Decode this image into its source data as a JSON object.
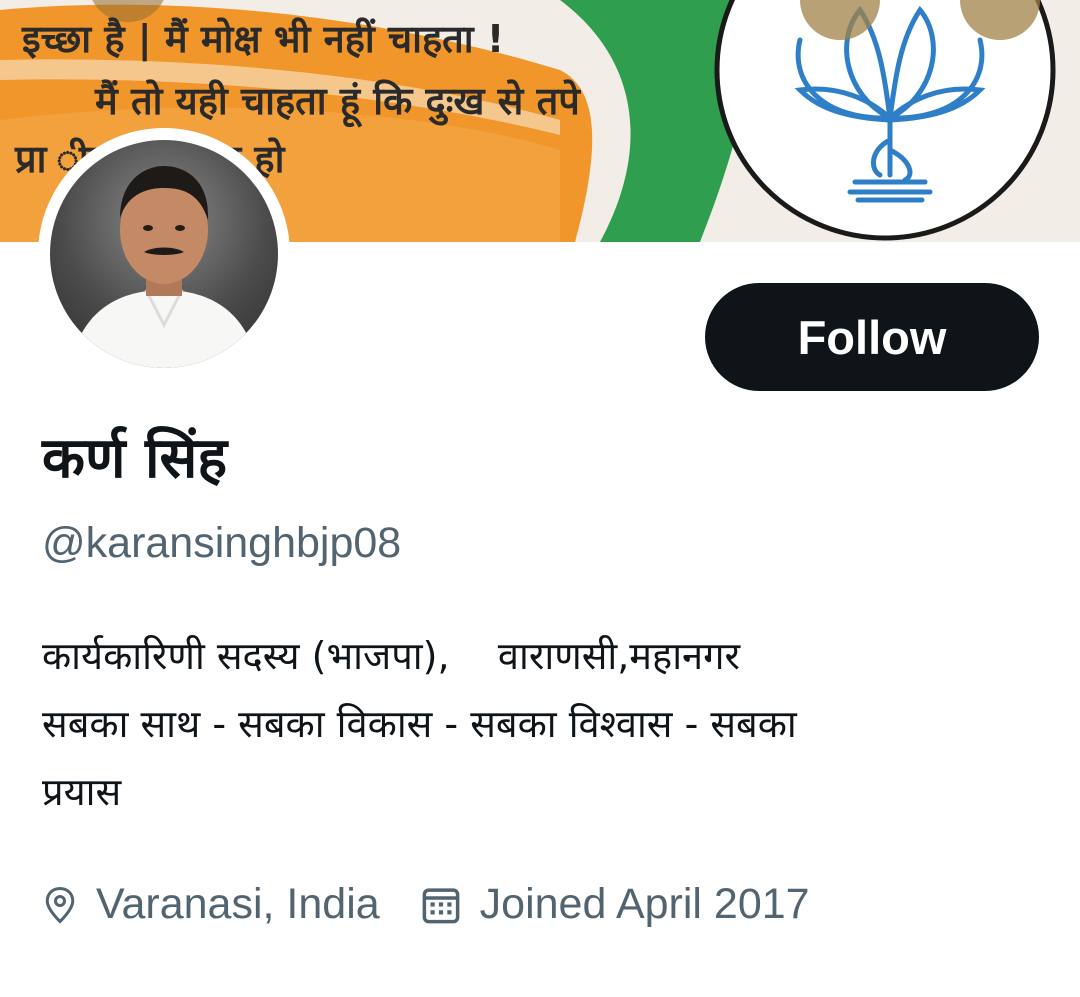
{
  "banner": {
    "lines": [
      "इच्छा है | मैं मोक्ष भी नहीं चाहता !",
      "मैं तो यही चाहता हूं कि दुःख से तपे",
      "प्रा       ीड़ा का नाश हो"
    ],
    "colors": {
      "saffron": "#f0962a",
      "green": "#2f9e4f",
      "lotus": "#2f7fc8"
    },
    "icons": [
      "search-icon",
      "more-icon"
    ]
  },
  "profile": {
    "display_name": "कर्ण सिंह",
    "handle": "@karansinghbjp08",
    "follow_label": "Follow",
    "bio": [
      "कार्यकारिणी सदस्य (भाजपा),    वाराणसी,महानगर",
      "सबका साथ - सबका विकास - सबका विश्वास - सबका",
      "प्रयास"
    ],
    "location": "Varanasi, India",
    "joined": "Joined April 2017",
    "location_icon": "location-pin-icon",
    "joined_icon": "calendar-icon"
  },
  "colors": {
    "text": "#0f1419",
    "secondary": "#536471",
    "button": "#0f1419"
  }
}
